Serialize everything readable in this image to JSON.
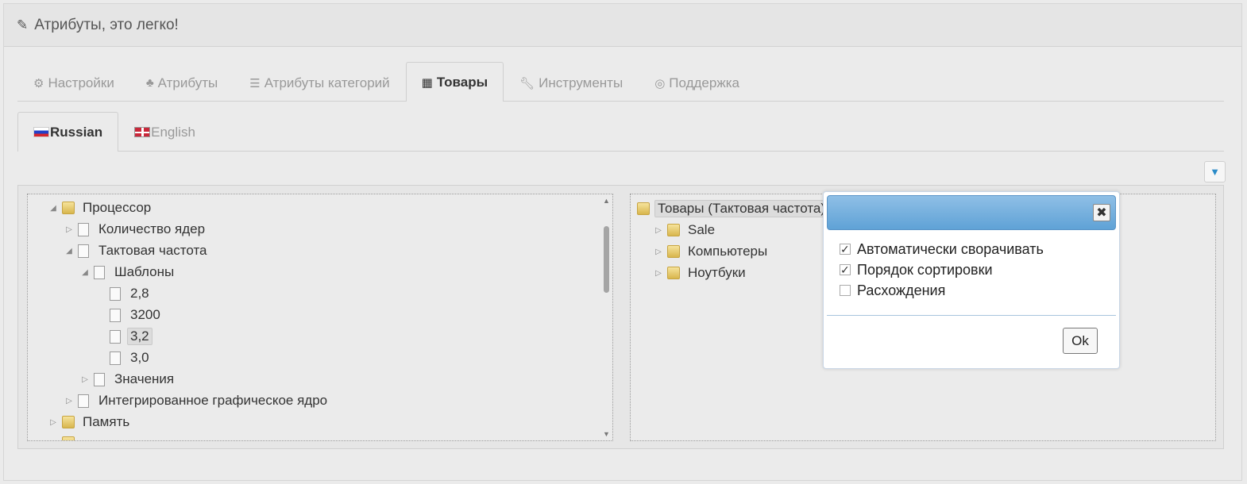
{
  "header": {
    "title": "Атрибуты, это легко!",
    "icon": "pencil-icon"
  },
  "main_tabs": [
    {
      "label": "Настройки",
      "icon": "gear-icon"
    },
    {
      "label": "Атрибуты",
      "icon": "tree-icon"
    },
    {
      "label": "Атрибуты категорий",
      "icon": "list-icon"
    },
    {
      "label": "Товары",
      "icon": "grid-icon",
      "active": true
    },
    {
      "label": "Инструменты",
      "icon": "wrench-icon"
    },
    {
      "label": "Поддержка",
      "icon": "lifebuoy-icon"
    }
  ],
  "lang_tabs": [
    {
      "label": "Russian",
      "active": true
    },
    {
      "label": "English"
    }
  ],
  "left_tree": [
    {
      "label": "Процессор"
    },
    {
      "label": "Количество ядер"
    },
    {
      "label": "Тактовая частота"
    },
    {
      "label": "Шаблоны"
    },
    {
      "label": "2,8"
    },
    {
      "label": "3200"
    },
    {
      "label": "3,2"
    },
    {
      "label": "3,0"
    },
    {
      "label": "Значения"
    },
    {
      "label": "Интегрированное графическое ядро"
    },
    {
      "label": "Память"
    }
  ],
  "right_tree": [
    {
      "label": "Товары (Тактовая частота)"
    },
    {
      "label": "Sale"
    },
    {
      "label": "Компьютеры"
    },
    {
      "label": "Ноутбуки"
    }
  ],
  "dialog": {
    "options": [
      {
        "label": "Автоматически сворачивать",
        "checked": true
      },
      {
        "label": "Порядок сортировки",
        "checked": true
      },
      {
        "label": "Расхождения",
        "checked": false
      }
    ],
    "ok_label": "Ok"
  },
  "colors": {
    "accent": "#5fa2d6",
    "filter": "#2a8bc8"
  }
}
